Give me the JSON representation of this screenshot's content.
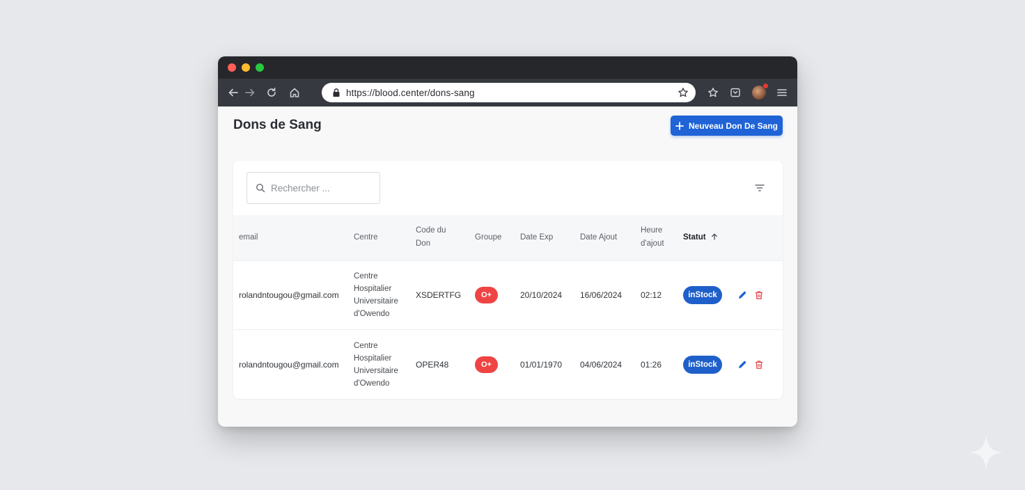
{
  "browser": {
    "url": "https://blood.center/dons-sang"
  },
  "header": {
    "title": "Dons de Sang",
    "new_button_label": "Neuveau Don De Sang"
  },
  "search": {
    "placeholder": "Rechercher ..."
  },
  "table": {
    "columns": [
      {
        "label": "email"
      },
      {
        "label": "Centre"
      },
      {
        "label": "Code du\nDon"
      },
      {
        "label": "Groupe"
      },
      {
        "label": "Date Exp"
      },
      {
        "label": "Date Ajout"
      },
      {
        "label": "Heure\nd'ajout"
      },
      {
        "label": "Statut",
        "sorted": "asc"
      }
    ],
    "rows": [
      {
        "email": "rolandntougou@gmail.com",
        "centre": "Centre\nHospitalier\nUniversitaire\nd'Owendo",
        "code": "XSDERTFG",
        "groupe": "O+",
        "date_exp": "20/10/2024",
        "date_ajout": "16/06/2024",
        "heure": "02:12",
        "statut": "inStock"
      },
      {
        "email": "rolandntougou@gmail.com",
        "centre": "Centre\nHospitalier\nUniversitaire\nd'Owendo",
        "code": "OPER48",
        "groupe": "O+",
        "date_exp": "01/01/1970",
        "date_ajout": "04/06/2024",
        "heure": "01:26",
        "statut": "inStock"
      }
    ]
  },
  "colors": {
    "primary": "#1f63d6",
    "group_badge": "#ef4444",
    "status_badge": "#1f5fc9",
    "delete_icon": "#e5484d"
  },
  "icons": [
    "back-arrow-icon",
    "forward-arrow-icon",
    "reload-icon",
    "home-icon",
    "lock-icon",
    "bookmark-star-icon",
    "star-icon",
    "pocket-icon",
    "avatar",
    "menu-icon",
    "plus-icon",
    "search-icon",
    "filter-icon",
    "sort-up-arrow-icon",
    "edit-pencil-icon",
    "trash-icon"
  ]
}
